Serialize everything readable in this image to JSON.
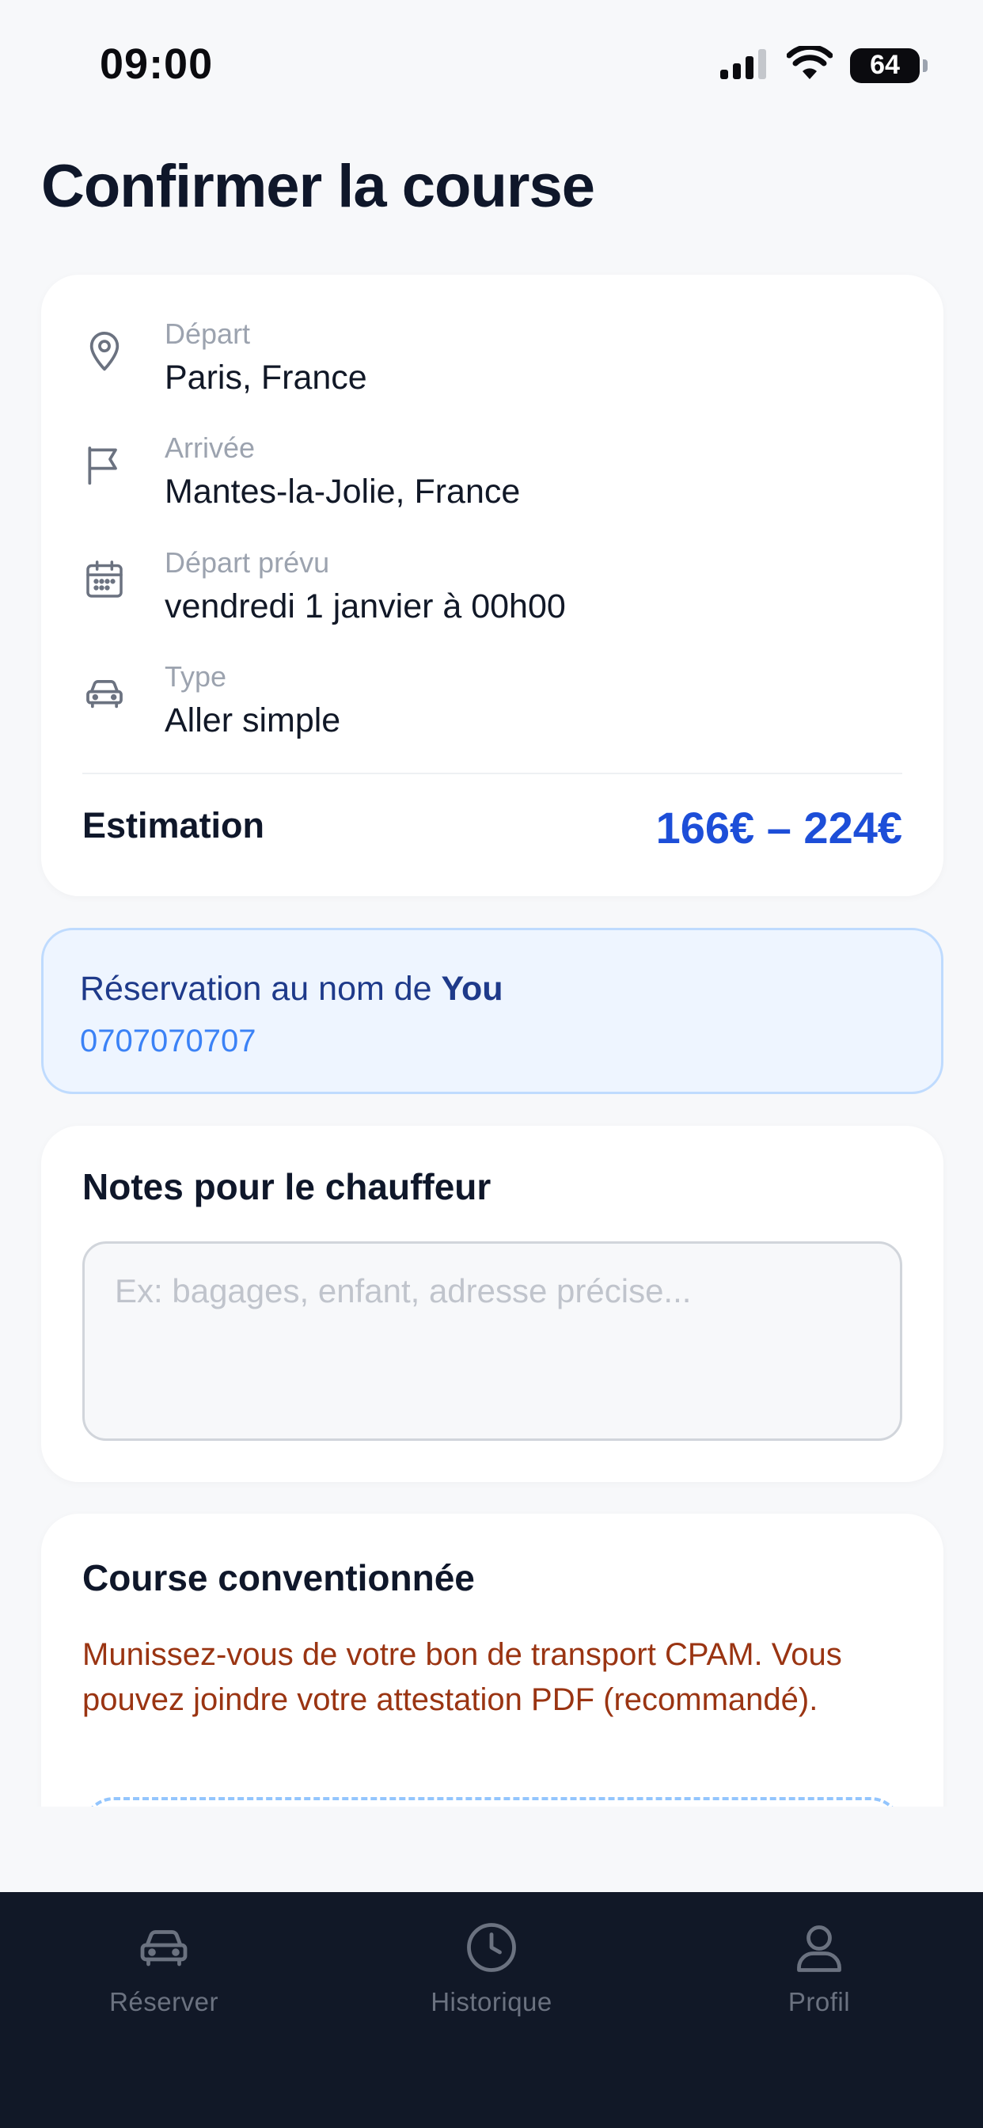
{
  "status_bar": {
    "time": "09:00",
    "battery": "64",
    "battery_level": 0.64
  },
  "page": {
    "title": "Confirmer la course"
  },
  "trip": {
    "rows": [
      {
        "icon": "map-pin-icon",
        "label": "Départ",
        "value": "Paris, France"
      },
      {
        "icon": "flag-icon",
        "label": "Arrivée",
        "value": "Mantes-la-Jolie, France"
      },
      {
        "icon": "calendar-icon",
        "label": "Départ prévu",
        "value": "vendredi 1 janvier à 00h00"
      },
      {
        "icon": "car-icon",
        "label": "Type",
        "value": "Aller simple"
      }
    ],
    "estimation_label": "Estimation",
    "estimation_value": "166€ – 224€"
  },
  "reservation": {
    "prefix": "Réservation au nom de ",
    "name": "You",
    "phone": "0707070707"
  },
  "notes": {
    "title": "Notes pour le chauffeur",
    "placeholder": "Ex: bagages, enfant, adresse précise...",
    "value": ""
  },
  "conventionnee": {
    "title": "Course conventionnée",
    "text": "Munissez-vous de votre bon de transport CPAM. Vous pouvez joindre votre attestation PDF (recommandé)."
  },
  "nav": {
    "items": [
      {
        "icon": "car-icon",
        "label": "Réserver"
      },
      {
        "icon": "clock-icon",
        "label": "Historique"
      },
      {
        "icon": "user-icon",
        "label": "Profil"
      }
    ]
  },
  "colors": {
    "accent": "#1d4ed8",
    "background": "#f7f8fa",
    "nav_background": "#111827",
    "warning_text": "#9a3412",
    "info_background": "#eef5ff"
  }
}
